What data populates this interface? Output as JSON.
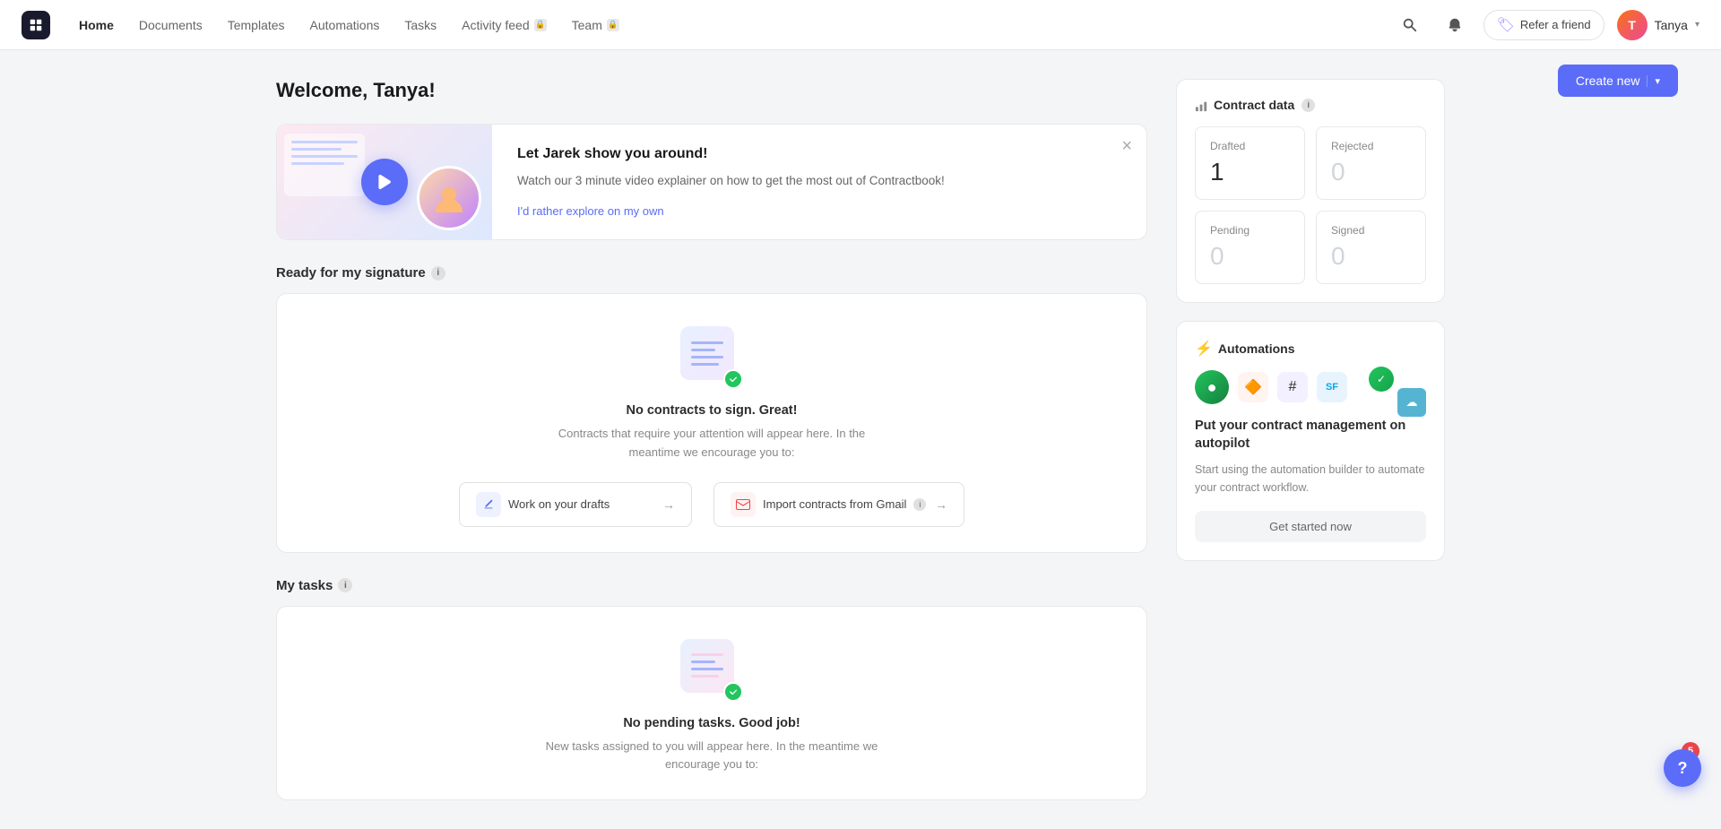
{
  "nav": {
    "logo_label": "CB",
    "items": [
      {
        "id": "home",
        "label": "Home",
        "active": true,
        "locked": false
      },
      {
        "id": "documents",
        "label": "Documents",
        "active": false,
        "locked": false
      },
      {
        "id": "templates",
        "label": "Templates",
        "active": false,
        "locked": false
      },
      {
        "id": "automations",
        "label": "Automations",
        "active": false,
        "locked": false
      },
      {
        "id": "tasks",
        "label": "Tasks",
        "active": false,
        "locked": false
      },
      {
        "id": "activity-feed",
        "label": "Activity feed",
        "active": false,
        "locked": true
      },
      {
        "id": "team",
        "label": "Team",
        "active": false,
        "locked": true
      }
    ],
    "refer_label": "Refer a friend",
    "user_name": "Tanya",
    "user_initials": "T"
  },
  "page": {
    "welcome_title": "Welcome, Tanya!",
    "create_new_label": "Create new"
  },
  "intro_card": {
    "title": "Let Jarek show you around!",
    "description": "Watch our 3 minute video explainer on how to get the most out of Contractbook!",
    "explore_link": "I'd rather explore on my own"
  },
  "ready_section": {
    "title": "Ready for my signature",
    "empty_title": "No contracts to sign. Great!",
    "empty_desc": "Contracts that require your attention will appear here. In the meantime we encourage you to:",
    "action1_label": "Work on your drafts",
    "action2_label": "Import contracts from Gmail"
  },
  "tasks_section": {
    "title": "My tasks",
    "empty_title": "No pending tasks. Good job!",
    "empty_desc": "New tasks assigned to you will appear here. In the meantime we encourage you to:"
  },
  "contract_data": {
    "section_title": "Contract data",
    "drafted_label": "Drafted",
    "drafted_value": "1",
    "rejected_label": "Rejected",
    "rejected_value": "0",
    "pending_label": "Pending",
    "pending_value": "0",
    "signed_label": "Signed",
    "signed_value": "0"
  },
  "automations": {
    "section_title": "Automations",
    "card_title": "Put your contract management on autopilot",
    "card_desc": "Start using the automation builder to automate your contract workflow.",
    "cta_label": "Get started now"
  },
  "help": {
    "badge_count": "5",
    "tooltip": "?"
  }
}
